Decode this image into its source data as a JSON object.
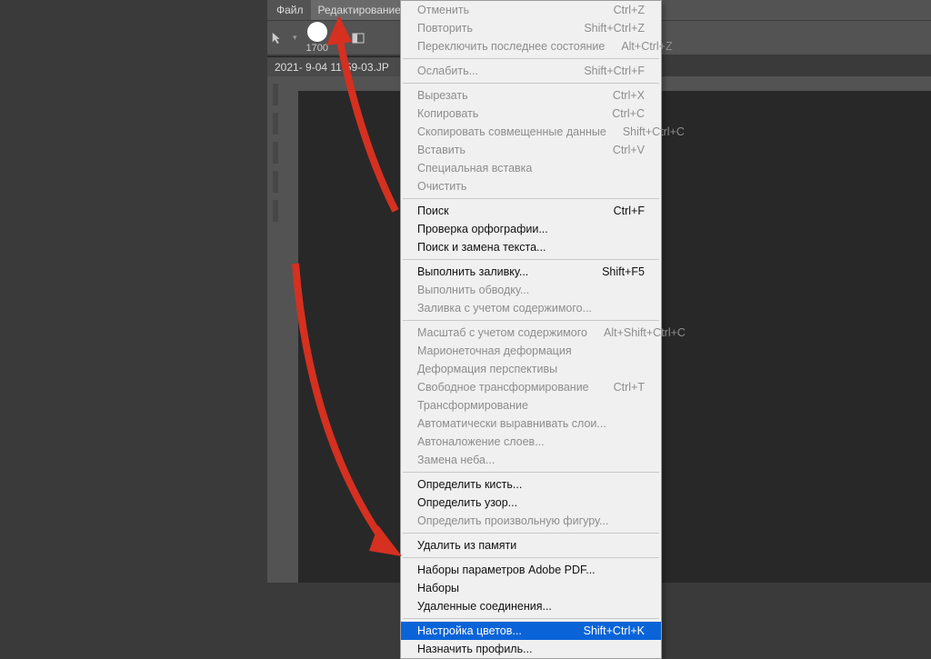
{
  "menubar": {
    "file": "Файл",
    "edit": "Редактирование"
  },
  "toolbar": {
    "brushSize": "1700"
  },
  "tab": {
    "name": "2021- 9-04 11-59-03.JP"
  },
  "dropdown": {
    "groups": [
      [
        {
          "label": "Отменить",
          "shortcut": "Ctrl+Z",
          "state": "disabled"
        },
        {
          "label": "Повторить",
          "shortcut": "Shift+Ctrl+Z",
          "state": "disabled"
        },
        {
          "label": "Переключить последнее состояние",
          "shortcut": "Alt+Ctrl+Z",
          "state": "disabled"
        }
      ],
      [
        {
          "label": "Ослабить...",
          "shortcut": "Shift+Ctrl+F",
          "state": "disabled"
        }
      ],
      [
        {
          "label": "Вырезать",
          "shortcut": "Ctrl+X",
          "state": "disabled"
        },
        {
          "label": "Копировать",
          "shortcut": "Ctrl+C",
          "state": "disabled"
        },
        {
          "label": "Скопировать совмещенные данные",
          "shortcut": "Shift+Ctrl+C",
          "state": "disabled"
        },
        {
          "label": "Вставить",
          "shortcut": "Ctrl+V",
          "state": "disabled"
        },
        {
          "label": "Специальная вставка",
          "shortcut": "",
          "state": "disabled"
        },
        {
          "label": "Очистить",
          "shortcut": "",
          "state": "disabled"
        }
      ],
      [
        {
          "label": "Поиск",
          "shortcut": "Ctrl+F",
          "state": "enabled"
        },
        {
          "label": "Проверка орфографии...",
          "shortcut": "",
          "state": "enabled"
        },
        {
          "label": "Поиск и замена текста...",
          "shortcut": "",
          "state": "enabled"
        }
      ],
      [
        {
          "label": "Выполнить заливку...",
          "shortcut": "Shift+F5",
          "state": "enabled"
        },
        {
          "label": "Выполнить обводку...",
          "shortcut": "",
          "state": "disabled"
        },
        {
          "label": "Заливка с учетом содержимого...",
          "shortcut": "",
          "state": "disabled"
        }
      ],
      [
        {
          "label": "Масштаб с учетом содержимого",
          "shortcut": "Alt+Shift+Ctrl+C",
          "state": "disabled"
        },
        {
          "label": "Марионеточная деформация",
          "shortcut": "",
          "state": "disabled"
        },
        {
          "label": "Деформация перспективы",
          "shortcut": "",
          "state": "disabled"
        },
        {
          "label": "Свободное трансформирование",
          "shortcut": "Ctrl+T",
          "state": "disabled"
        },
        {
          "label": "Трансформирование",
          "shortcut": "",
          "state": "disabled"
        },
        {
          "label": "Автоматически выравнивать слои...",
          "shortcut": "",
          "state": "disabled"
        },
        {
          "label": "Автоналожение слоев...",
          "shortcut": "",
          "state": "disabled"
        },
        {
          "label": "Замена неба...",
          "shortcut": "",
          "state": "disabled"
        }
      ],
      [
        {
          "label": "Определить кисть...",
          "shortcut": "",
          "state": "enabled"
        },
        {
          "label": "Определить узор...",
          "shortcut": "",
          "state": "enabled"
        },
        {
          "label": "Определить произвольную фигуру...",
          "shortcut": "",
          "state": "disabled"
        }
      ],
      [
        {
          "label": "Удалить из памяти",
          "shortcut": "",
          "state": "enabled"
        }
      ],
      [
        {
          "label": "Наборы параметров Adobe PDF...",
          "shortcut": "",
          "state": "enabled"
        },
        {
          "label": "Наборы",
          "shortcut": "",
          "state": "enabled"
        },
        {
          "label": "Удаленные соединения...",
          "shortcut": "",
          "state": "enabled"
        }
      ],
      [
        {
          "label": "Настройка цветов...",
          "shortcut": "Shift+Ctrl+K",
          "state": "highlight"
        },
        {
          "label": "Назначить профиль...",
          "shortcut": "",
          "state": "enabled"
        }
      ]
    ]
  }
}
